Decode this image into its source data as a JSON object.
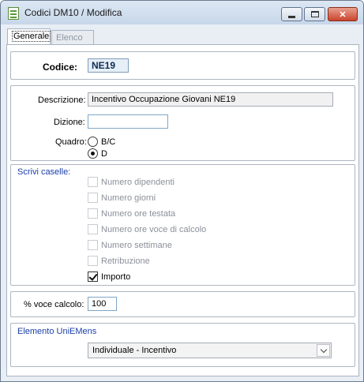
{
  "window": {
    "title": "Codici DM10 / Modifica"
  },
  "tabs": [
    {
      "label": "Generale"
    },
    {
      "label": "Elenco"
    }
  ],
  "codice": {
    "label": "Codice:",
    "value": "NE19"
  },
  "descrizione": {
    "label": "Descrizione:",
    "value": "Incentivo Occupazione Giovani NE19"
  },
  "dizione": {
    "label": "Dizione:",
    "value": ""
  },
  "quadro": {
    "label": "Quadro:",
    "options": [
      {
        "label": "B/C",
        "selected": false
      },
      {
        "label": "D",
        "selected": true
      }
    ]
  },
  "scrivi_caselle": {
    "title": "Scrivi caselle:",
    "items": [
      {
        "label": "Numero dipendenti",
        "checked": false,
        "enabled": false
      },
      {
        "label": "Numero giorni",
        "checked": false,
        "enabled": false
      },
      {
        "label": "Numero ore testata",
        "checked": false,
        "enabled": false
      },
      {
        "label": "Numero ore voce di calcolo",
        "checked": false,
        "enabled": false
      },
      {
        "label": "Numero settimane",
        "checked": false,
        "enabled": false
      },
      {
        "label": "Retribuzione",
        "checked": false,
        "enabled": false
      },
      {
        "label": "Importo",
        "checked": true,
        "enabled": true
      }
    ]
  },
  "voce_calcolo": {
    "label": "% voce calcolo:",
    "value": "100"
  },
  "elemento_uniemens": {
    "title": "Elemento UniEMens",
    "selected": "Individuale - Incentivo"
  }
}
